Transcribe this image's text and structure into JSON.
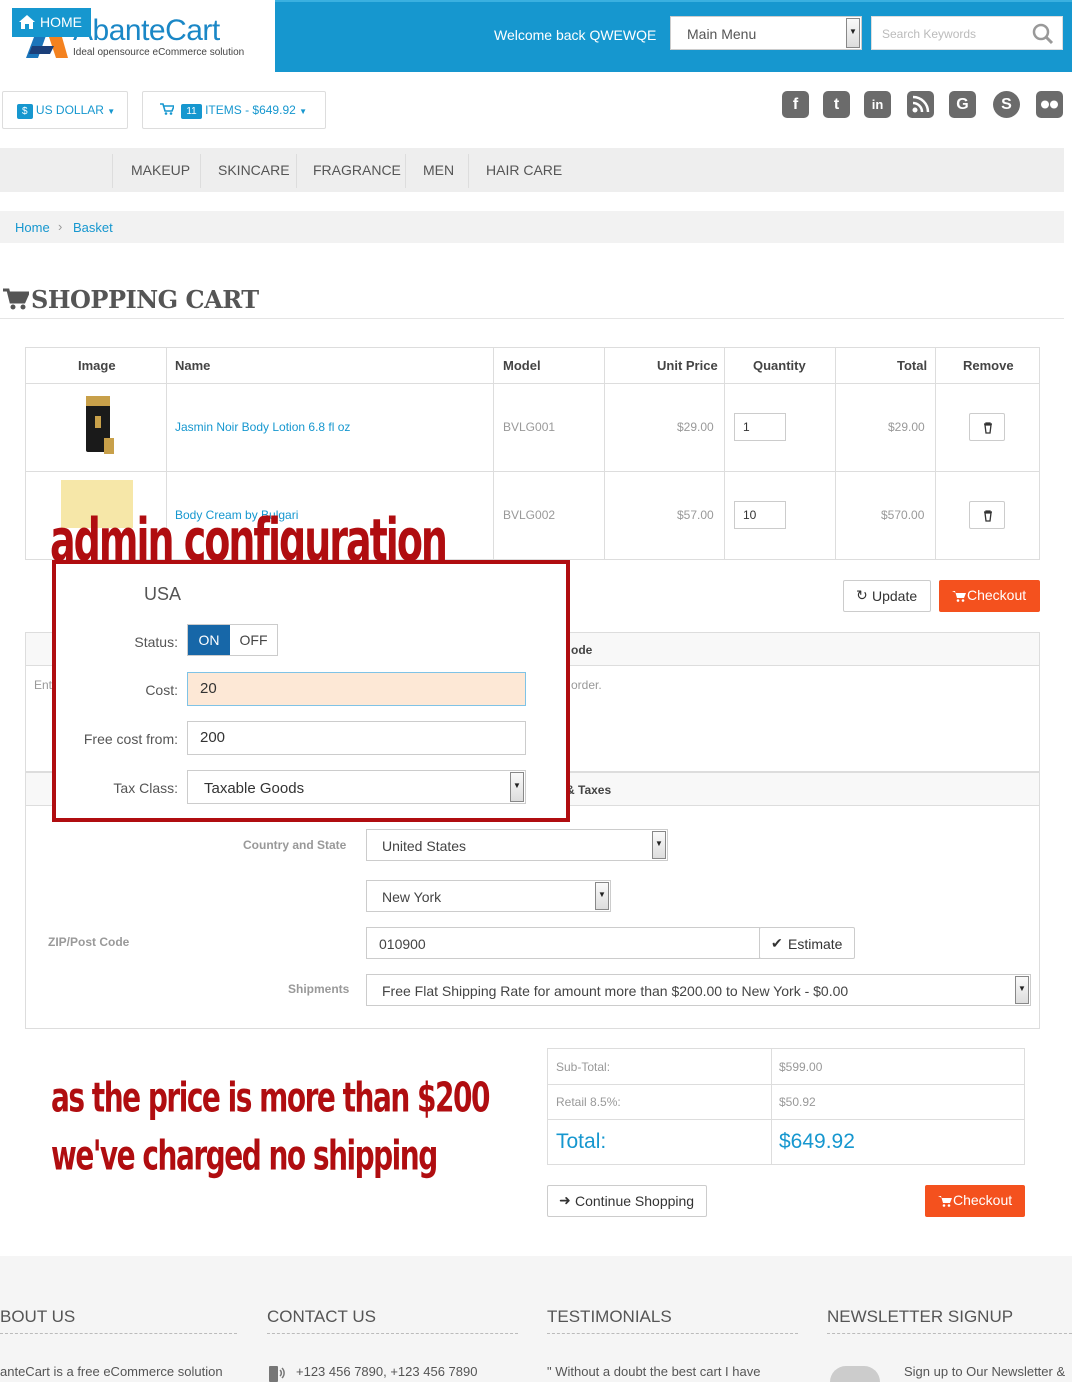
{
  "header": {
    "logo_title": "AbanteCart",
    "logo_tagline": "Ideal opensource eCommerce solution",
    "welcome": "Welcome back QWEWQE",
    "main_menu": "Main Menu",
    "search_placeholder": "Search Keywords"
  },
  "currency": {
    "symbol": "$",
    "label": "US DOLLAR"
  },
  "cart_summary": {
    "count": "11",
    "label": "ITEMS - $649.92"
  },
  "social_icons": [
    "facebook-icon",
    "twitter-icon",
    "linkedin-icon",
    "rss-icon",
    "google-icon",
    "skype-icon",
    "flickr-icon"
  ],
  "nav": {
    "home": "HOME",
    "items": [
      "MAKEUP",
      "SKINCARE",
      "FRAGRANCE",
      "MEN",
      "HAIR CARE"
    ]
  },
  "breadcrumb": {
    "home": "Home",
    "current": "Basket"
  },
  "page_title": "SHOPPING CART",
  "cart_table": {
    "headers": [
      "Image",
      "Name",
      "Model",
      "Unit Price",
      "Quantity",
      "Total",
      "Remove"
    ],
    "rows": [
      {
        "name": "Jasmin Noir Body Lotion 6.8 fl oz",
        "model": "BVLG001",
        "unit_price": "$29.00",
        "quantity": "1",
        "total": "$29.00"
      },
      {
        "name": "Body Cream by Bulgari",
        "model": "BVLG002",
        "unit_price": "$57.00",
        "quantity": "10",
        "total": "$570.00"
      }
    ]
  },
  "buttons": {
    "update": "Update",
    "checkout": "Checkout",
    "estimate": "Estimate",
    "continue": "Continue Shopping"
  },
  "coupon_panel": {
    "title_fragment": "ode",
    "text_left": "Ent",
    "text_right": "order."
  },
  "estimate_panel": {
    "title_fragment": "& Taxes",
    "country_label": "Country and State",
    "country_value": "United States",
    "state_value": "New York",
    "zip_label": "ZIP/Post Code",
    "zip_value": "010900",
    "shipments_label": "Shipments",
    "shipments_value": "Free Flat Shipping Rate for amount more than $200.00 to New York - $0.00"
  },
  "admin_config": {
    "annotation": "admin configuration",
    "region": "USA",
    "status_label": "Status:",
    "status_on": "ON",
    "status_off": "OFF",
    "cost_label": "Cost:",
    "cost_value": "20",
    "free_cost_label": "Free cost from:",
    "free_cost_value": "200",
    "tax_class_label": "Tax Class:",
    "tax_class_value": "Taxable Goods"
  },
  "note": {
    "line1": "as the price is more than $200",
    "line2": "we've charged no shipping"
  },
  "totals": {
    "subtotal_label": "Sub-Total:",
    "subtotal_value": "$599.00",
    "tax_label": "Retail 8.5%:",
    "tax_value": "$50.92",
    "total_label": "Total:",
    "total_value": "$649.92"
  },
  "footer": {
    "about_title": "BOUT US",
    "about_text": "anteCart is a free eCommerce solution",
    "contact_title": "CONTACT US",
    "contact_text": "+123 456 7890, +123 456 7890",
    "testimonials_title": "TESTIMONIALS",
    "testimonials_text": "\" Without a doubt the best cart I have",
    "newsletter_title": "NEWSLETTER SIGNUP",
    "newsletter_text": "Sign up to Our Newsletter &"
  },
  "colors": {
    "brand_blue": "#1697cf",
    "checkout_orange": "#f4511e",
    "annotation_red": "#b00d10"
  }
}
